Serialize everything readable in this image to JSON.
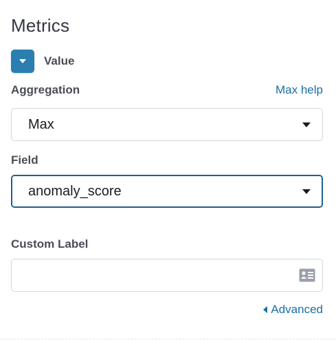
{
  "section": {
    "title": "Metrics"
  },
  "metric": {
    "toggle_label": "Value"
  },
  "aggregation": {
    "label": "Aggregation",
    "help_link": "Max help",
    "selected": "Max"
  },
  "field": {
    "label": "Field",
    "selected": "anomaly_score"
  },
  "custom_label": {
    "label": "Custom Label",
    "value": ""
  },
  "advanced": {
    "link": "Advanced"
  },
  "colors": {
    "accent": "#2a7fb0",
    "link": "#1a6fa5",
    "focus_border": "#1d5f8d"
  }
}
